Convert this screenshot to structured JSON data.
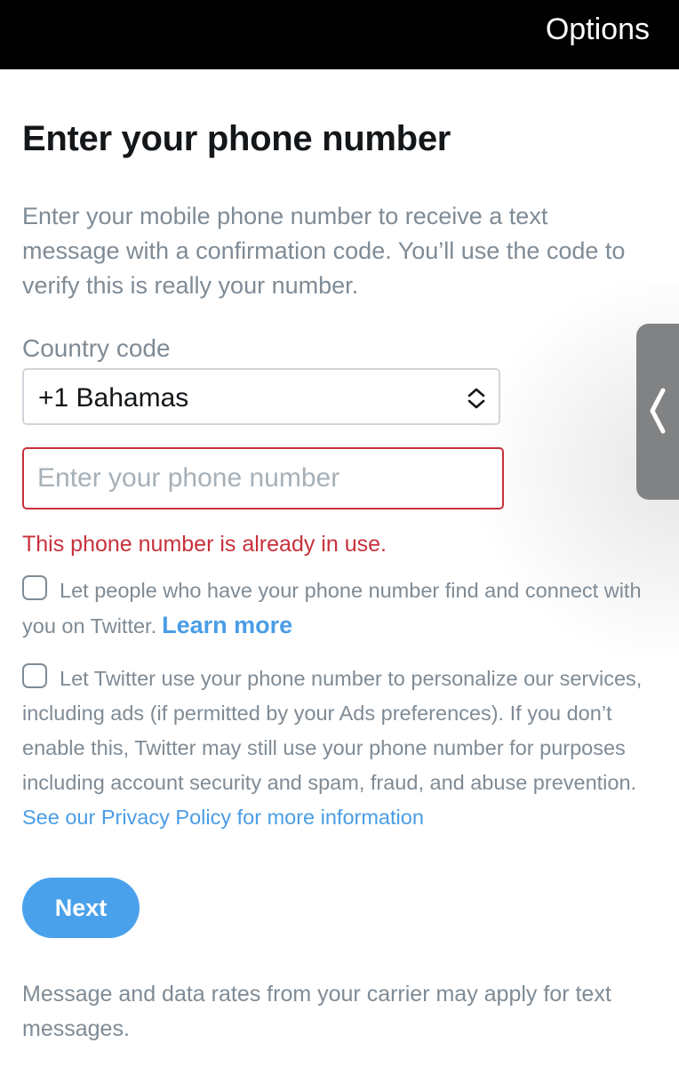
{
  "header": {
    "options_label": "Options"
  },
  "form": {
    "title": "Enter your phone number",
    "description": "Enter your mobile phone number to receive a text message with a confirmation code. You’ll use the code to verify this is really your number.",
    "country_label": "Country code",
    "country_value": "+1 Bahamas",
    "phone_placeholder": "Enter your phone number",
    "phone_value": "",
    "error_message": "This phone number is already in use.",
    "discover_text": "Let people who have your phone number find and connect with you on Twitter.",
    "learn_more": "Learn more",
    "personalize_text": "Let Twitter use your phone number to personalize our services, including ads (if permitted by your Ads preferences). If you don’t enable this, Twitter may still use your phone number for purposes including account security and spam, fraud, and abuse prevention.",
    "privacy_link": "See our Privacy Policy for more information",
    "next_label": "Next",
    "footnote": "Message and data rates from your carrier may apply for text messages."
  },
  "icons": {
    "select_arrows": "chevron-up-down-icon",
    "side_tab": "chevron-left-icon"
  },
  "colors": {
    "accent": "#4aa1eb",
    "error": "#c8313b",
    "muted_text": "#7f8b95"
  }
}
